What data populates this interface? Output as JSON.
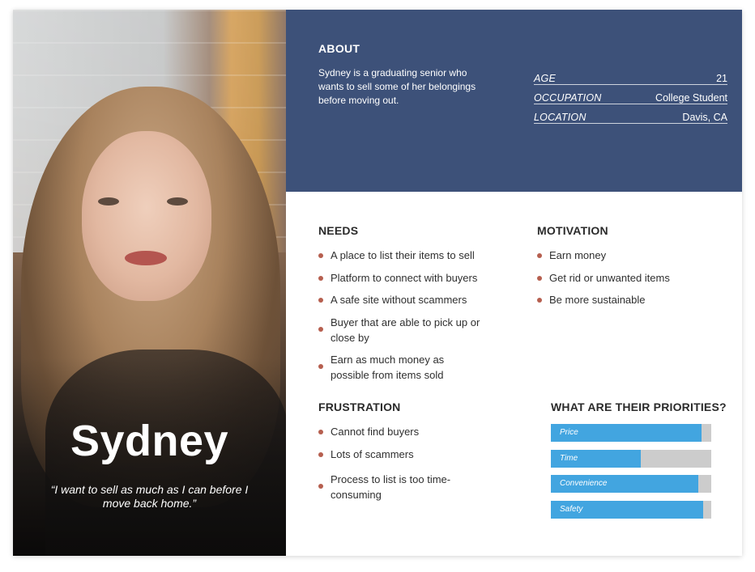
{
  "persona": {
    "name": "Sydney",
    "quote": "“I want to sell as much as I can before I move back home.”"
  },
  "about": {
    "heading": "ABOUT",
    "text": "Sydney is a graduating senior who wants to sell some of her belongings before moving out.",
    "facts": [
      {
        "label": "AGE",
        "value": "21"
      },
      {
        "label": "OCCUPATION",
        "value": "College Student"
      },
      {
        "label": "LOCATION",
        "value": "Davis, CA"
      }
    ]
  },
  "needs": {
    "heading": "NEEDS",
    "items": [
      "A place to list their items to sell",
      "Platform to connect with buyers",
      "A safe site without scammers",
      "Buyer that are able to pick up or close by",
      "Earn as much money as possible from items sold"
    ]
  },
  "motivation": {
    "heading": "MOTIVATION",
    "items": [
      "Earn money",
      "Get rid or unwanted items",
      "Be more sustainable"
    ]
  },
  "frustration": {
    "heading": "FRUSTRATION",
    "items": [
      "Cannot find buyers",
      "Lots of scammers",
      "Process to list is too time-consuming"
    ]
  },
  "priorities": {
    "heading": "WHAT ARE THEIR PRIORITIES?",
    "items": [
      {
        "label": "Price",
        "level": 0.94
      },
      {
        "label": "Time",
        "level": 0.56
      },
      {
        "label": "Convenience",
        "level": 0.92
      },
      {
        "label": "Safety",
        "level": 0.95
      }
    ]
  },
  "colors": {
    "about_background": "#3d5179",
    "bullet": "#b65f4f",
    "bar_fill": "#42a5e0",
    "bar_track": "#cccccc"
  }
}
